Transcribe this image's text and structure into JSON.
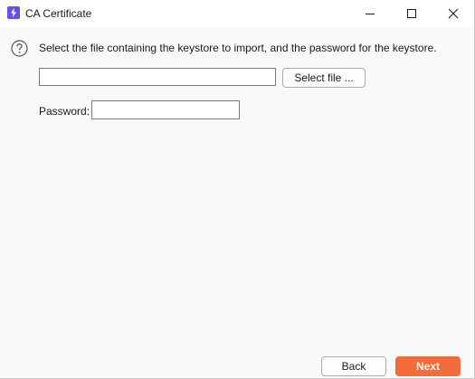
{
  "window": {
    "title": "CA Certificate",
    "icon": "lightning-icon",
    "controls": {
      "minimize": "minimize-icon",
      "maximize": "maximize-icon",
      "close": "close-icon"
    }
  },
  "main": {
    "help_icon": "question-circle-icon",
    "instruction": "Select the file containing the keystore to import, and the password for the keystore.",
    "file_field": {
      "value": "",
      "placeholder": ""
    },
    "select_file_label": "Select file ...",
    "password_label": "Password:",
    "password_field": {
      "value": ""
    }
  },
  "footer": {
    "back_label": "Back",
    "next_label": "Next"
  },
  "colors": {
    "accent": "#f26b3a",
    "app_icon": "#6c4de6",
    "background": "#f9f9f9",
    "titlebar": "#ffffff"
  }
}
